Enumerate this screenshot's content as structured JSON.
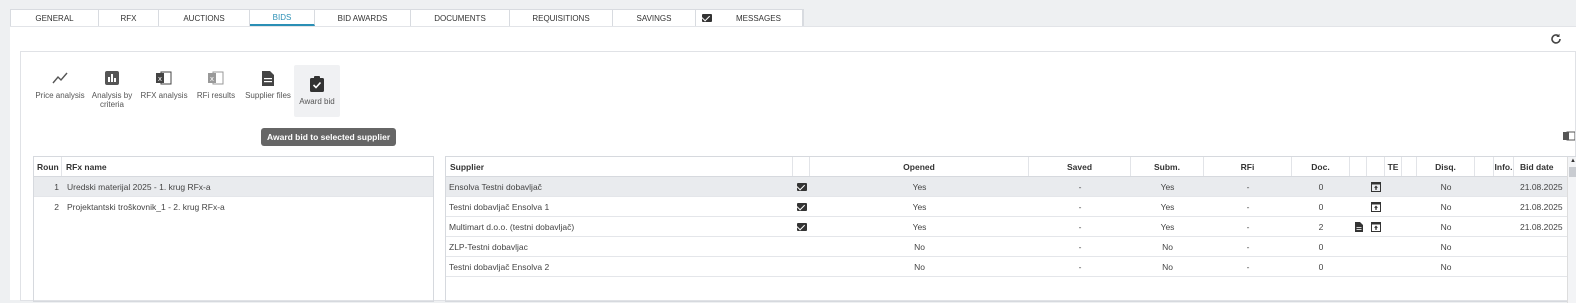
{
  "tabs": [
    {
      "label": "GENERAL"
    },
    {
      "label": "RFX"
    },
    {
      "label": "AUCTIONS"
    },
    {
      "label": "BIDS"
    },
    {
      "label": "BID AWARDS"
    },
    {
      "label": "DOCUMENTS"
    },
    {
      "label": "REQUISITIONS"
    },
    {
      "label": "SAVINGS"
    },
    {
      "label": "MESSAGES"
    }
  ],
  "active_tab": "BIDS",
  "toolbar": {
    "price_analysis": "Price analysis",
    "analysis_by_criteria": "Analysis by criteria",
    "rfx_analysis": "RFX analysis",
    "rfi_results": "RFi results",
    "supplier_files": "Supplier files",
    "award_bid": "Award bid"
  },
  "tooltip": "Award bid to selected supplier",
  "left_table": {
    "headers": {
      "round": "Roun",
      "rfx_name": "RFx name"
    },
    "rows": [
      {
        "round": "1",
        "name": "Uredski materijal 2025 - 1. krug RFx-a"
      },
      {
        "round": "2",
        "name": "Projektantski troškovnik_1 - 2. krug RFx-a"
      }
    ]
  },
  "right_table": {
    "headers": {
      "supplier": "Supplier",
      "opened": "Opened",
      "saved": "Saved",
      "subm": "Subm.",
      "rfi": "RFi",
      "doc": "Doc.",
      "te": "TE",
      "disq": "Disq.",
      "info": "Info.",
      "bid_date": "Bid date"
    },
    "rows": [
      {
        "supplier": "Ensolva Testni dobavljač",
        "opened": "Yes",
        "saved": "-",
        "subm": "Yes",
        "rfi": "-",
        "doc": "0",
        "disq": "No",
        "bid_date": "21.08.2025"
      },
      {
        "supplier": "Testni dobavljač Ensolva 1",
        "opened": "Yes",
        "saved": "-",
        "subm": "Yes",
        "rfi": "-",
        "doc": "0",
        "disq": "No",
        "bid_date": "21.08.2025"
      },
      {
        "supplier": "Multimart d.o.o. (testni dobavljač)",
        "opened": "Yes",
        "saved": "-",
        "subm": "Yes",
        "rfi": "-",
        "doc": "2",
        "disq": "No",
        "bid_date": "21.08.2025"
      },
      {
        "supplier": "ZLP-Testni dobavljac",
        "opened": "No",
        "saved": "-",
        "subm": "No",
        "rfi": "-",
        "doc": "0",
        "disq": "No",
        "bid_date": ""
      },
      {
        "supplier": "Testni dobavljač Ensolva 2",
        "opened": "No",
        "saved": "-",
        "subm": "No",
        "rfi": "-",
        "doc": "0",
        "disq": "No",
        "bid_date": ""
      }
    ]
  },
  "colors": {
    "accent": "#2a8fb5",
    "selected_row": "#e9ebee",
    "tooltip_bg": "#666666"
  }
}
